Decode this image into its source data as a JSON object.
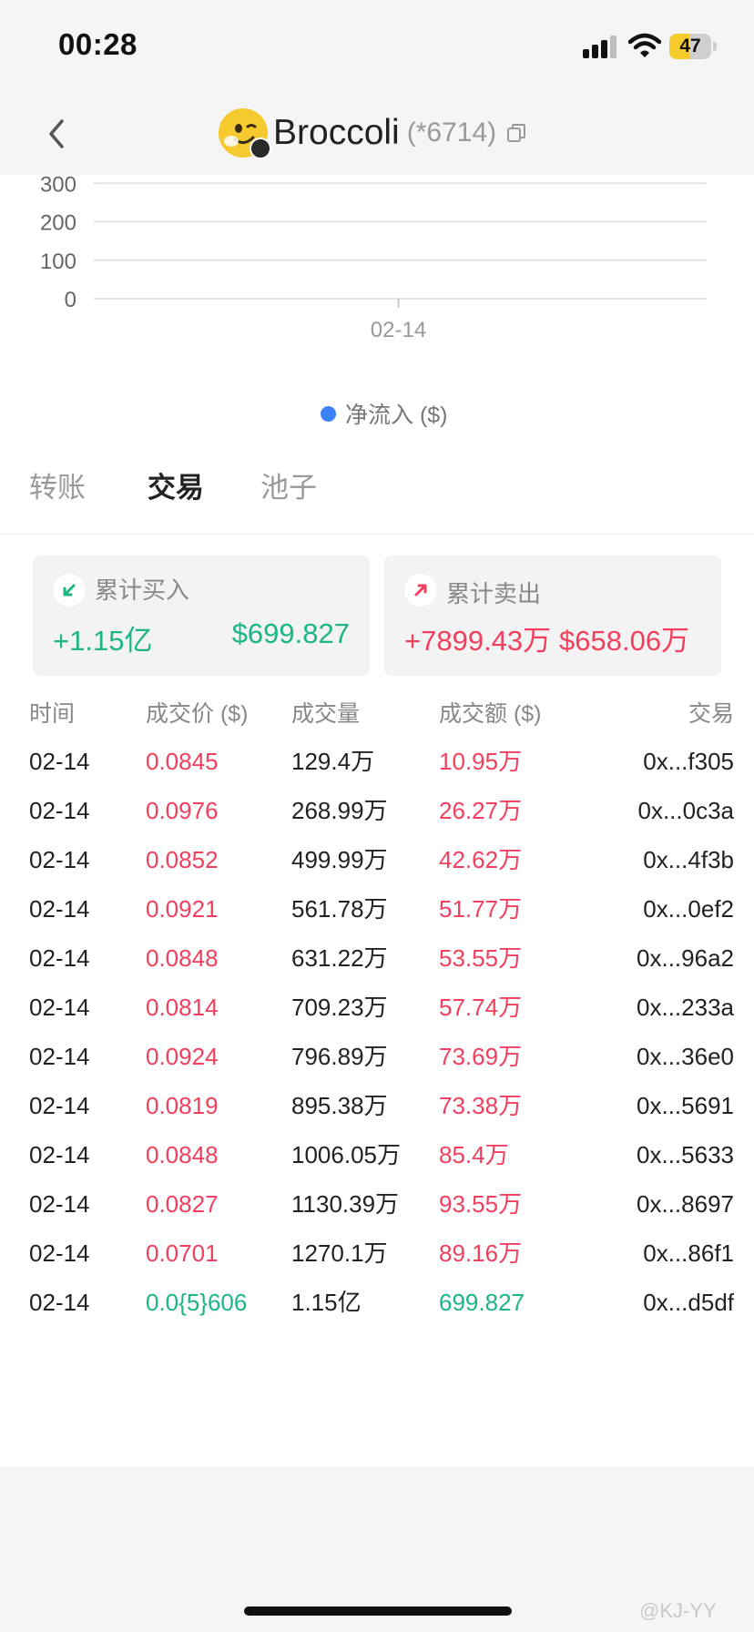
{
  "status_bar": {
    "time": "00:28",
    "battery": "47",
    "battery_level": 0.47,
    "icons": [
      "cellular-signal-icon",
      "wifi-icon",
      "battery-icon"
    ]
  },
  "header": {
    "title": "Broccoli",
    "code": "(*6714)",
    "icons": [
      "back-icon",
      "token-avatar",
      "copy-icon"
    ]
  },
  "chart_data": {
    "type": "bar",
    "categories": [
      "02-14"
    ],
    "series": [
      {
        "name": "净流入 ($)",
        "color": "#3b82f6",
        "values": [
          0
        ]
      }
    ],
    "yticks": [
      "400",
      "300",
      "200",
      "100",
      "0"
    ],
    "ylim": [
      0,
      400
    ],
    "grid": true,
    "legend": "bottom"
  },
  "tabs": [
    {
      "label": "转账",
      "active": false
    },
    {
      "label": "交易",
      "active": true
    },
    {
      "label": "池子",
      "active": false
    }
  ],
  "summary": {
    "buy": {
      "title": "累计买入",
      "qty": "+1.15亿",
      "amount": "$699.827",
      "icon": "arrow-down-left-icon",
      "color": "#1db586"
    },
    "sell": {
      "title": "累计卖出",
      "qty": "+7899.43万",
      "amount": "$658.06万",
      "icon": "arrow-up-right-icon",
      "color": "#f0405e"
    }
  },
  "table": {
    "headers": [
      "时间",
      "成交价 ($)",
      "成交量",
      "成交额 ($)",
      "交易"
    ],
    "rows": [
      {
        "time": "02-14",
        "price": "0.0845",
        "qty": "129.4万",
        "amount": "10.95万",
        "tx": "0x...f305",
        "side": "sell"
      },
      {
        "time": "02-14",
        "price": "0.0976",
        "qty": "268.99万",
        "amount": "26.27万",
        "tx": "0x...0c3a",
        "side": "sell"
      },
      {
        "time": "02-14",
        "price": "0.0852",
        "qty": "499.99万",
        "amount": "42.62万",
        "tx": "0x...4f3b",
        "side": "sell"
      },
      {
        "time": "02-14",
        "price": "0.0921",
        "qty": "561.78万",
        "amount": "51.77万",
        "tx": "0x...0ef2",
        "side": "sell"
      },
      {
        "time": "02-14",
        "price": "0.0848",
        "qty": "631.22万",
        "amount": "53.55万",
        "tx": "0x...96a2",
        "side": "sell"
      },
      {
        "time": "02-14",
        "price": "0.0814",
        "qty": "709.23万",
        "amount": "57.74万",
        "tx": "0x...233a",
        "side": "sell"
      },
      {
        "time": "02-14",
        "price": "0.0924",
        "qty": "796.89万",
        "amount": "73.69万",
        "tx": "0x...36e0",
        "side": "sell"
      },
      {
        "time": "02-14",
        "price": "0.0819",
        "qty": "895.38万",
        "amount": "73.38万",
        "tx": "0x...5691",
        "side": "sell"
      },
      {
        "time": "02-14",
        "price": "0.0848",
        "qty": "1006.05万",
        "amount": "85.4万",
        "tx": "0x...5633",
        "side": "sell"
      },
      {
        "time": "02-14",
        "price": "0.0827",
        "qty": "1130.39万",
        "amount": "93.55万",
        "tx": "0x...8697",
        "side": "sell"
      },
      {
        "time": "02-14",
        "price": "0.0701",
        "qty": "1270.1万",
        "amount": "89.16万",
        "tx": "0x...86f1",
        "side": "sell"
      },
      {
        "time": "02-14",
        "price": "0.0{5}606",
        "qty": "1.15亿",
        "amount": "699.827",
        "tx": "0x...d5df",
        "side": "buy"
      }
    ],
    "colors": {
      "buy": "#1db586",
      "sell": "#f0405e"
    }
  },
  "watermark": "@KJ-YY"
}
